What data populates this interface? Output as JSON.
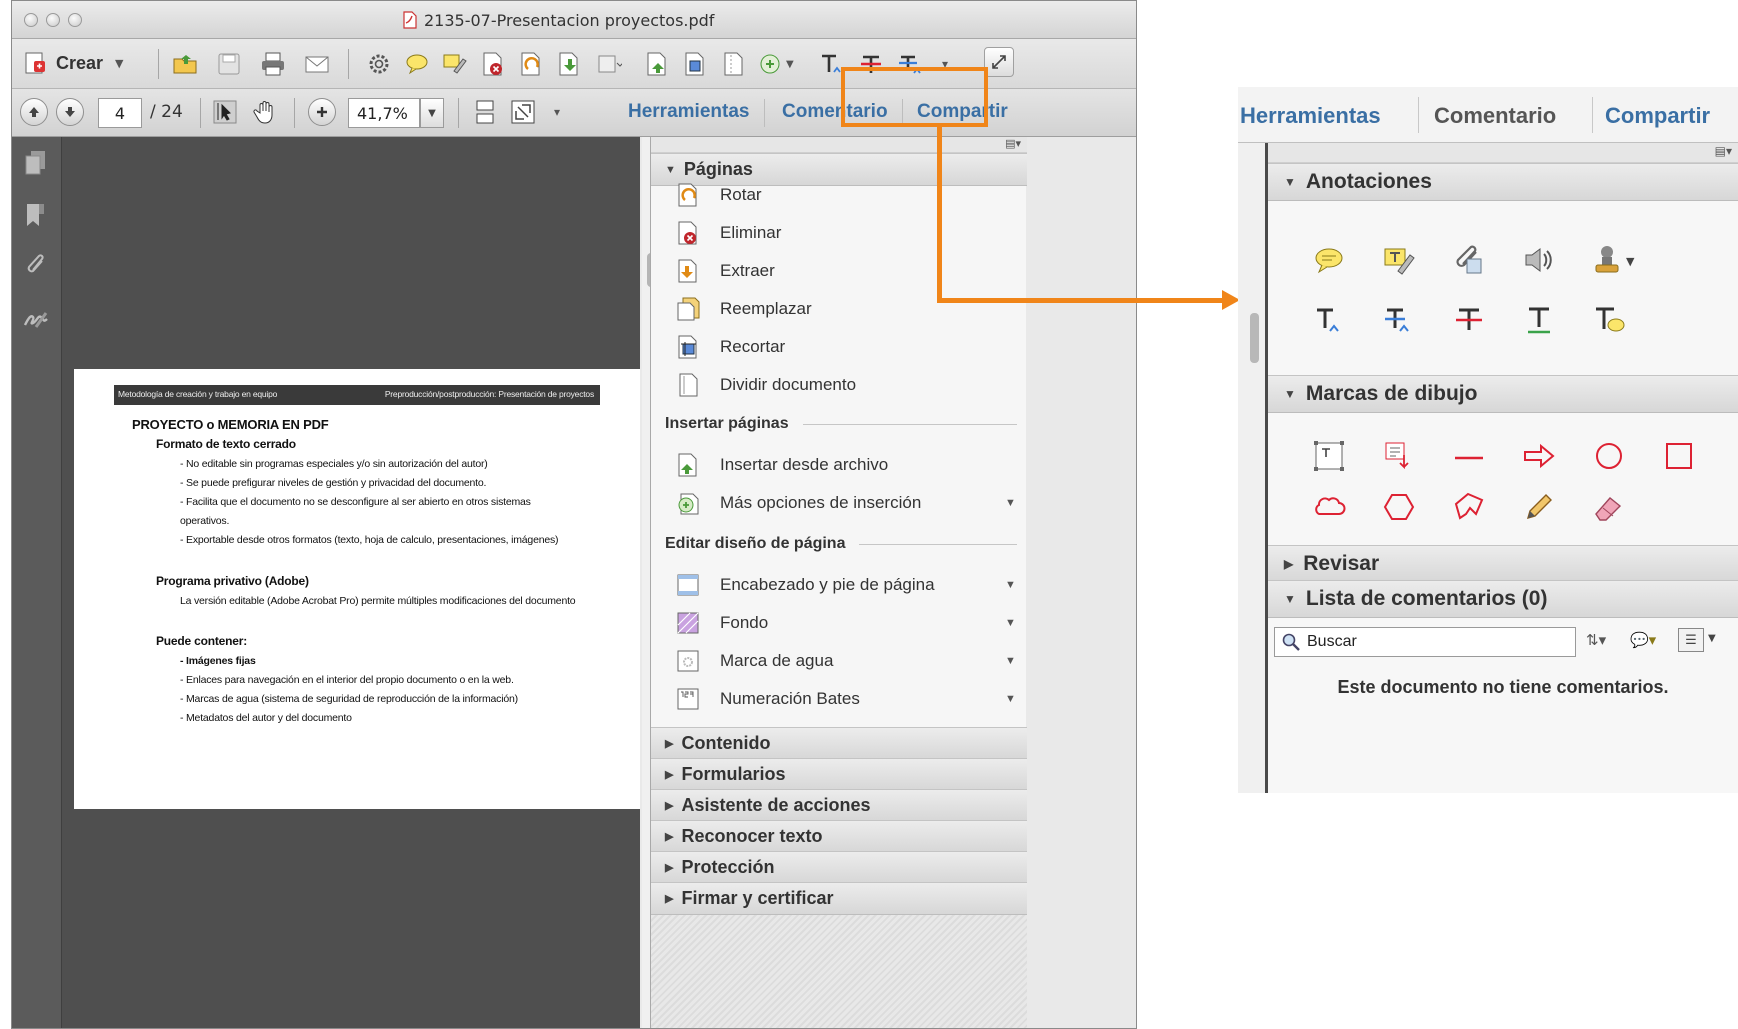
{
  "window": {
    "title": "2135-07-Presentacion proyectos.pdf"
  },
  "toolbar": {
    "create_label": "Crear",
    "page_current": "4",
    "page_total": "/ 24",
    "zoom_value": "41,7%"
  },
  "tabs": [
    {
      "label": "Herramientas"
    },
    {
      "label": "Comentario"
    },
    {
      "label": "Compartir"
    }
  ],
  "document": {
    "header_left": "Metodología de creación y trabajo en equipo",
    "header_right": "Preproducción/postproducción: Presentación de proyectos",
    "title": "PROYECTO o MEMORIA EN PDF",
    "s1_heading": "Formato de texto cerrado",
    "s1_lines": [
      "- No editable sin programas especiales y/o sin autorización del autor)",
      "- Se puede prefigurar niveles de gestión y privacidad del documento.",
      "- Facilita que el documento no se desconfigure al ser abierto en otros sistemas",
      "operativos.",
      "- Exportable desde otros formatos (texto, hoja de calculo, presentaciones, imágenes)"
    ],
    "s2_heading": "Programa privativo (Adobe)",
    "s2_lines": [
      "La versión editable (Adobe Acrobat Pro) permite múltiples modificaciones del documento"
    ],
    "s3_heading": "Puede contener:",
    "s3_lines": [
      "- Imágenes fijas",
      "- Enlaces para navegación en el interior del propio documento o en la web.",
      "- Marcas de agua (sistema de seguridad de reproducción de la información)",
      "- Metadatos del autor y del documento"
    ]
  },
  "tools_pane": {
    "paginas_header": "Páginas",
    "paginas_items": [
      {
        "label": "Rotar",
        "icon": "rotate-page-icon"
      },
      {
        "label": "Eliminar",
        "icon": "delete-page-icon"
      },
      {
        "label": "Extraer",
        "icon": "extract-page-icon"
      },
      {
        "label": "Reemplazar",
        "icon": "replace-page-icon"
      },
      {
        "label": "Recortar",
        "icon": "crop-page-icon"
      },
      {
        "label": "Dividir documento",
        "icon": "split-document-icon"
      }
    ],
    "insertar_label": "Insertar páginas",
    "insertar_items": [
      {
        "label": "Insertar desde archivo",
        "icon": "insert-file-icon"
      },
      {
        "label": "Más opciones de inserción",
        "icon": "more-insert-icon"
      }
    ],
    "editar_label": "Editar diseño de página",
    "editar_items": [
      {
        "label": "Encabezado y pie de página",
        "icon": "header-footer-icon"
      },
      {
        "label": "Fondo",
        "icon": "background-icon"
      },
      {
        "label": "Marca de agua",
        "icon": "watermark-icon"
      },
      {
        "label": "Numeración Bates",
        "icon": "bates-numbering-icon"
      }
    ],
    "collapsed_sections": [
      {
        "label": "Contenido"
      },
      {
        "label": "Formularios"
      },
      {
        "label": "Asistente de acciones"
      },
      {
        "label": "Reconocer texto"
      },
      {
        "label": "Protección"
      },
      {
        "label": "Firmar y certificar"
      }
    ]
  },
  "comment_panel": {
    "anotaciones_header": "Anotaciones",
    "marcas_header": "Marcas de dibujo",
    "revisar_header": "Revisar",
    "lista_header": "Lista de comentarios (0)",
    "search_placeholder": "Buscar",
    "empty_message": "Este documento no tiene comentarios."
  },
  "colors": {
    "tab_text": "#3a6fa4",
    "callout": "#f08519"
  }
}
